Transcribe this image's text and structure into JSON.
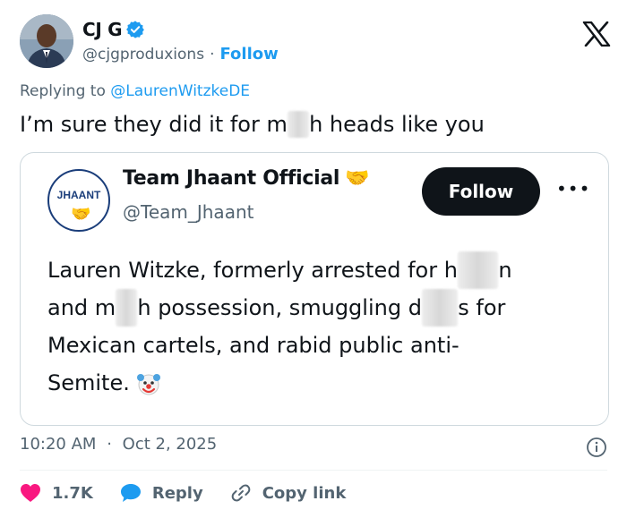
{
  "author": {
    "name": "CJ G",
    "handle": "@cjgproduxions",
    "separator": "·",
    "follow_label": "Follow"
  },
  "replying": {
    "prefix": "Replying to",
    "mention": "@LaurenWitzkeDE"
  },
  "tweet": {
    "text_a": "I’m sure they did it for m",
    "text_redacted": "et",
    "text_b": "h heads like you"
  },
  "quoted": {
    "avatar_logo_text": "JHAANT",
    "name": "Team Jhaant Official",
    "handle": "@Team_Jhaant",
    "follow_label": "Follow",
    "more_label": "•••",
    "body": {
      "line1_a": "Lauren Witzke, formerly arrested for h",
      "line1_redacted": "eroi",
      "line1_b": "n",
      "line2_a": "and m",
      "line2_redacted": "et",
      "line2_b": "h possession, smuggling d",
      "line2_redacted2": "rug",
      "line2_c": "s for",
      "line3": "Mexican cartels, and rabid public anti-",
      "line4": "Semite."
    }
  },
  "meta": {
    "time": "10:20 AM",
    "separator": "·",
    "date": "Oct 2, 2025"
  },
  "actions": {
    "like_count": "1.7K",
    "reply_label": "Reply",
    "copy_label": "Copy link"
  },
  "colors": {
    "accent": "#1d9bf0",
    "like": "#f91880",
    "text": "#0f1419",
    "muted": "#536471",
    "border": "#cfd9de"
  },
  "icons": {
    "verified": "verified-badge-icon",
    "x_logo": "x-logo-icon",
    "info": "info-icon",
    "like": "heart-icon",
    "reply": "reply-bubble-icon",
    "copy": "link-icon",
    "handshake": "handshake-emoji-icon",
    "clown": "clown-face-emoji-icon"
  }
}
